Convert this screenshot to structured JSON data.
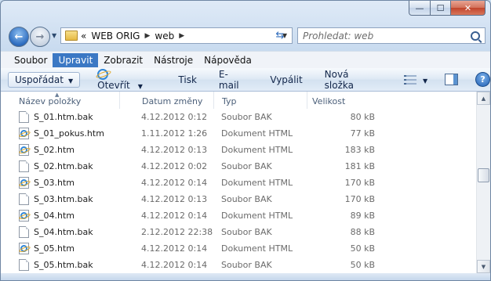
{
  "window": {
    "controls": {
      "minimize": "—",
      "maximize": "☐",
      "close": "✕"
    }
  },
  "nav": {
    "back_icon": "back-arrow-icon",
    "forward_icon": "forward-arrow-icon",
    "address": {
      "overflow": "«",
      "crumbs": [
        "WEB ORIG",
        "web"
      ],
      "separator": "▶"
    },
    "search_placeholder": "Prohledat: web"
  },
  "menu": {
    "items": [
      {
        "label": "Soubor",
        "active": false
      },
      {
        "label": "Upravit",
        "active": true
      },
      {
        "label": "Zobrazit",
        "active": false
      },
      {
        "label": "Nástroje",
        "active": false
      },
      {
        "label": "Nápověda",
        "active": false
      }
    ]
  },
  "toolbar": {
    "organize": "Uspořádat",
    "open": "Otevřít",
    "print": "Tisk",
    "email": "E-mail",
    "burn": "Vypálit",
    "new_folder": "Nová složka",
    "help": "?"
  },
  "columns": {
    "name": "Název položky",
    "date": "Datum změny",
    "type": "Typ",
    "size": "Velikost"
  },
  "files": [
    {
      "name": "S_01.htm.bak",
      "date": "4.12.2012 0:12",
      "type": "Soubor BAK",
      "size": "80 kB",
      "icon": "bak"
    },
    {
      "name": "S_01_pokus.htm",
      "date": "1.11.2012 1:26",
      "type": "Dokument HTML",
      "size": "77 kB",
      "icon": "html"
    },
    {
      "name": "S_02.htm",
      "date": "4.12.2012 0:13",
      "type": "Dokument HTML",
      "size": "183 kB",
      "icon": "html"
    },
    {
      "name": "S_02.htm.bak",
      "date": "4.12.2012 0:02",
      "type": "Soubor BAK",
      "size": "181 kB",
      "icon": "bak"
    },
    {
      "name": "S_03.htm",
      "date": "4.12.2012 0:14",
      "type": "Dokument HTML",
      "size": "170 kB",
      "icon": "html"
    },
    {
      "name": "S_03.htm.bak",
      "date": "4.12.2012 0:13",
      "type": "Soubor BAK",
      "size": "170 kB",
      "icon": "bak"
    },
    {
      "name": "S_04.htm",
      "date": "4.12.2012 0:14",
      "type": "Dokument HTML",
      "size": "89 kB",
      "icon": "html"
    },
    {
      "name": "S_04.htm.bak",
      "date": "2.12.2012 22:38",
      "type": "Soubor BAK",
      "size": "88 kB",
      "icon": "bak"
    },
    {
      "name": "S_05.htm",
      "date": "4.12.2012 0:14",
      "type": "Dokument HTML",
      "size": "50 kB",
      "icon": "html"
    },
    {
      "name": "S_05.htm.bak",
      "date": "4.12.2012 0:14",
      "type": "Soubor BAK",
      "size": "50 kB",
      "icon": "bak"
    }
  ]
}
